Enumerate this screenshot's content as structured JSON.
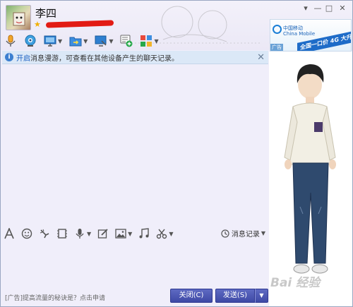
{
  "contact": {
    "name": "李四"
  },
  "window_controls": {
    "menu": "▾",
    "minimize": "—",
    "maximize": "□",
    "close": "✕"
  },
  "toolbar": {
    "items": [
      {
        "icon": "microphone-icon",
        "has_menu": false
      },
      {
        "icon": "video-camera-icon",
        "has_menu": false
      },
      {
        "icon": "remote-desktop-icon",
        "has_menu": true
      },
      {
        "icon": "file-transfer-icon",
        "has_menu": true
      },
      {
        "icon": "screen-share-icon",
        "has_menu": true
      },
      {
        "icon": "create-group-icon",
        "has_menu": false
      },
      {
        "icon": "apps-icon",
        "has_menu": true
      }
    ]
  },
  "ad_top": {
    "brand_cn": "中国移动",
    "brand_en": "China Mobile",
    "slogan": "全国一口价 4G 大升级",
    "tag": "广告"
  },
  "notice": {
    "link": "开启",
    "text": "消息漫游，可查看在其他设备产生的聊天记录。",
    "close": "✕"
  },
  "input_toolbar": {
    "history_label": "消息记录",
    "items": [
      "font-icon",
      "emoji-icon",
      "poke-icon",
      "video-clip-icon",
      "voice-icon",
      "doodle-icon",
      "image-icon",
      "music-icon",
      "screenshot-icon"
    ]
  },
  "footer": {
    "ad_text": "[广告]提高流量的秘诀是？点击申请",
    "close_label": "关闭(C)",
    "send_label": "发送(S)",
    "send_menu": "▼"
  },
  "watermark": "Bai 经验",
  "colors": {
    "accent": "#3e49a6",
    "notice_bg": "#dbe8f7",
    "link": "#1b60c2"
  }
}
